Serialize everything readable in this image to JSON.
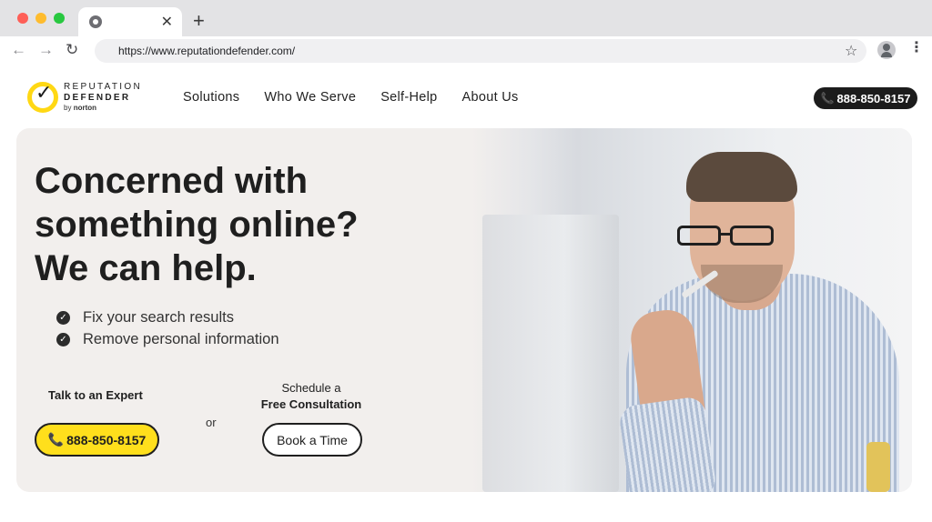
{
  "browser": {
    "tab": {
      "title": ""
    },
    "new_tab_symbol": "+",
    "close_symbol": "✕",
    "address_bar": {
      "url": "https://www.reputationdefender.com/"
    }
  },
  "site": {
    "logo": {
      "line1": "REPUTATION",
      "line2": "DEFENDER",
      "by": "by",
      "brand": "norton",
      "accent_color": "#ffd814"
    },
    "nav": [
      {
        "label": "Solutions"
      },
      {
        "label": "Who We Serve"
      },
      {
        "label": "Self-Help"
      },
      {
        "label": "About Us"
      }
    ],
    "header_phone": "888-850-8157"
  },
  "hero": {
    "title_lines": [
      "Concerned with",
      "something online?",
      "We can help."
    ],
    "bullets": [
      "Fix your search results",
      "Remove personal information"
    ],
    "expert": {
      "label": "Talk to an Expert",
      "phone": "888-850-8157",
      "button_color": "#ffdf1c"
    },
    "or": "or",
    "schedule": {
      "line1": "Schedule a",
      "line2": "Free Consultation",
      "button": "Book a Time"
    }
  }
}
